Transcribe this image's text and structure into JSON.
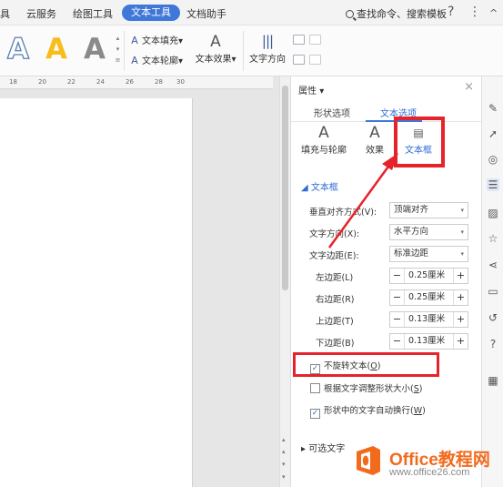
{
  "menubar": {
    "items": [
      "具",
      "云服务",
      "绘图工具",
      "文本工具",
      "文档助手"
    ],
    "active_index": 3,
    "search_text": "查找命令、搜索模板",
    "help_icon": "?",
    "more_icon": "⋮",
    "collapse_icon": "^"
  },
  "ribbon": {
    "style_glyph": "A",
    "text_fill_label": "文本填充",
    "text_outline_label": "文本轮廓",
    "text_effect_label": "文本效果",
    "text_direction_label": "文字方向",
    "dropdown_mark": "▾"
  },
  "ruler": {
    "marks": [
      "18",
      "20",
      "22",
      "24",
      "26",
      "28",
      "30"
    ]
  },
  "panel": {
    "title": "属性",
    "close": "×",
    "tabs": [
      "形状选项",
      "文本选项"
    ],
    "active_tab": 1,
    "subtabs": [
      "填充与轮廓",
      "效果",
      "文本框"
    ],
    "active_subtab": 2,
    "section_title": "文本框",
    "rows": {
      "valign": {
        "label": "垂直对齐方式(V):",
        "value": "顶端对齐"
      },
      "direction": {
        "label": "文字方向(X):",
        "value": "水平方向"
      },
      "margin": {
        "label": "文字边距(E):",
        "value": "标准边距"
      },
      "left": {
        "label": "左边距(L)",
        "value": "0.25厘米"
      },
      "right": {
        "label": "右边距(R)",
        "value": "0.25厘米"
      },
      "top": {
        "label": "上边距(T)",
        "value": "0.13厘米"
      },
      "bottom": {
        "label": "下边距(B)",
        "value": "0.13厘米"
      }
    },
    "checks": {
      "no_rotate": {
        "label": "不旋转文本(",
        "key": "O",
        "suffix": ")",
        "checked": true
      },
      "resize": {
        "label": "根据文字调整形状大小(",
        "key": "S",
        "suffix": ")",
        "checked": false
      },
      "wrap": {
        "label": "形状中的文字自动换行(",
        "key": "W",
        "suffix": ")",
        "checked": true
      }
    },
    "collapsed_section": "可选文字",
    "minus": "−",
    "plus": "+",
    "check_mark": "✓"
  },
  "watermark": {
    "title": "Office教程网",
    "url": "www.office26.com"
  },
  "colors": {
    "accent": "#3f78d8",
    "highlight_red": "#e6222a",
    "watermark_orange": "#f26b1d"
  }
}
